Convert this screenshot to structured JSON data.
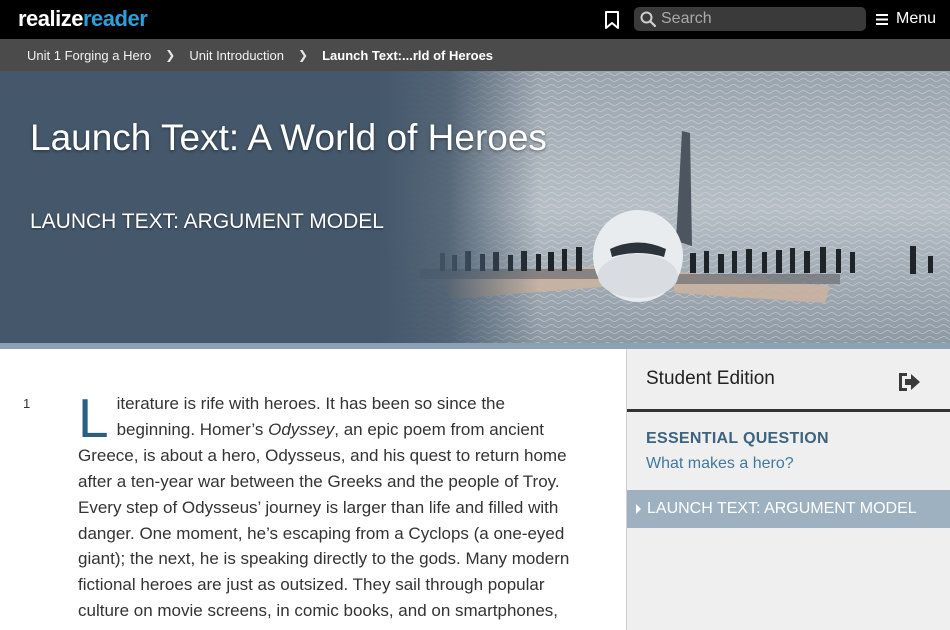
{
  "brand": {
    "part1": "realize",
    "part2": "reader"
  },
  "header": {
    "search_placeholder": "Search",
    "menu_label": "Menu"
  },
  "breadcrumb": {
    "items": [
      "Unit 1 Forging a Hero",
      "Unit Introduction",
      "Launch Text:...rld of Heroes"
    ]
  },
  "banner": {
    "title": "Launch Text: A World of Heroes",
    "subtitle": "LAUNCH TEXT: ARGUMENT MODEL"
  },
  "article": {
    "paragraph_number": "1",
    "drop_cap": "L",
    "text_before_title": "iterature is rife with heroes. It has been so since the beginning. Homer’s ",
    "italic_title": "Odyssey",
    "text_after_title": ", an epic poem from ancient Greece, is about a hero, Odysseus, and his quest to return home after a ten-year war between the Greeks and the people of Troy. Every step of Odysseus’ journey is larger than life and filled with danger. One moment, he’s escaping from a Cyclops (a one-eyed giant); the next, he is speaking directly to the gods. Many modern fictional heroes are just as outsized. They sail through popular culture on movie screens, in comic books, and on smartphones,"
  },
  "side_panel": {
    "title": "Student Edition",
    "essential_question_heading": "ESSENTIAL QUESTION",
    "essential_question": "What makes a hero?",
    "toc_items": [
      "LAUNCH TEXT: ARGUMENT MODEL"
    ]
  },
  "colors": {
    "topbar": "#000000",
    "logo_accent": "#2e9fd8",
    "breadcrumb_bg": "#4b4b4b",
    "banner_bg": "#45586b",
    "dropcap": "#2a5f85",
    "eq_heading": "#3c6480",
    "toc_active_bg": "#9eb1c0"
  },
  "icons": {
    "bookmark": "bookmark-icon",
    "search": "search-icon",
    "menu": "hamburger-icon",
    "exit": "exit-panel-icon"
  }
}
